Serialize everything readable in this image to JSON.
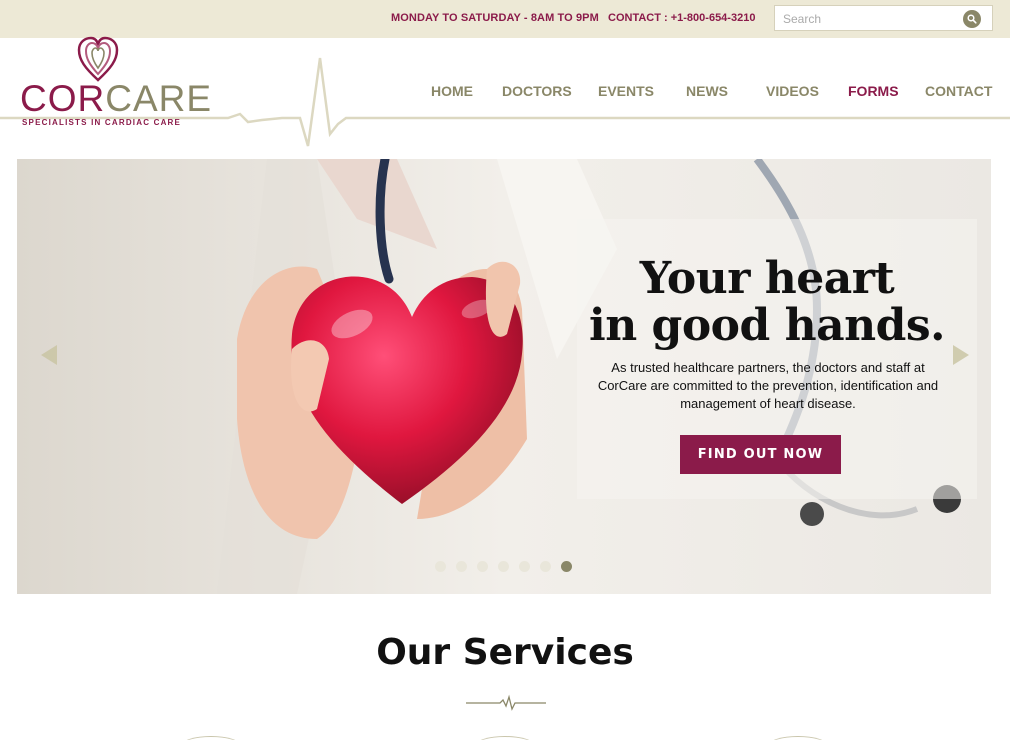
{
  "topbar": {
    "hours": "MONDAY TO SATURDAY - 8AM TO 9PM",
    "contact": "CONTACT : +1-800-654-3210",
    "search_placeholder": "Search",
    "search_icon": "search-icon"
  },
  "logo": {
    "word_cor": "COR",
    "word_care": "CARE",
    "tagline": "SPECIALISTS IN CARDIAC CARE"
  },
  "nav": {
    "items": [
      {
        "label": "HOME"
      },
      {
        "label": "DOCTORS"
      },
      {
        "label": "EVENTS"
      },
      {
        "label": "NEWS"
      },
      {
        "label": "VIDEOS"
      },
      {
        "label": "FORMS",
        "active": true
      },
      {
        "label": "CONTACT"
      }
    ]
  },
  "hero": {
    "title_line1": "Your heart",
    "title_line2": "in good hands.",
    "text": "As trusted healthcare partners, the doctors and staff at CorCare are committed to the prevention, identification and management of heart disease.",
    "cta": "FIND OUT NOW",
    "slide_count": 7,
    "active_slide": 7
  },
  "services": {
    "title": "Our Services"
  },
  "colors": {
    "brand": "#8b1b4a",
    "olive": "#8a8768",
    "topbar_bg": "#ede9d6"
  }
}
